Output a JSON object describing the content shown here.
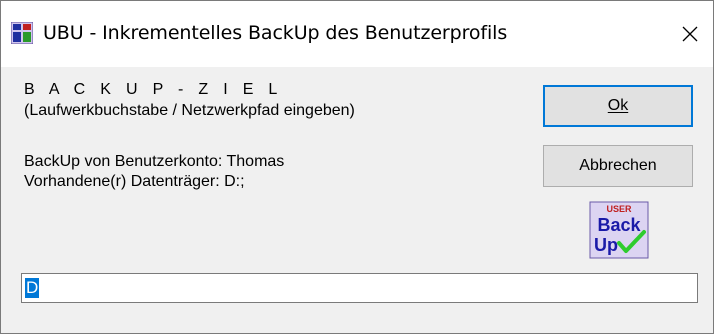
{
  "window": {
    "title": "UBU - Inkrementelles BackUp des Benutzerprofils",
    "app_icon": "userbackup-app-icon",
    "close_icon": "close-icon"
  },
  "content": {
    "heading": "B A C K U P - Z I E L",
    "subheading": "(Laufwerkbuchstabe / Netzwerkpfad eingeben)",
    "account_line": "BackUp von Benutzerkonto: Thomas",
    "drives_line": "Vorhandene(r) Datenträger: D:;"
  },
  "buttons": {
    "ok_label": "Ok",
    "cancel_label": "Abbrechen"
  },
  "logo": {
    "top_text": "USER",
    "line1": "Back",
    "line2": "Up",
    "check_icon": "checkmark-icon",
    "color_text": "#1a1aa8",
    "color_top": "#c02020",
    "color_check": "#2ecc2e"
  },
  "path_field": {
    "value": "D",
    "selected": true
  },
  "colors": {
    "accent": "#0078d7",
    "window_bg": "#f0f0f0",
    "button_bg": "#e1e1e1"
  }
}
